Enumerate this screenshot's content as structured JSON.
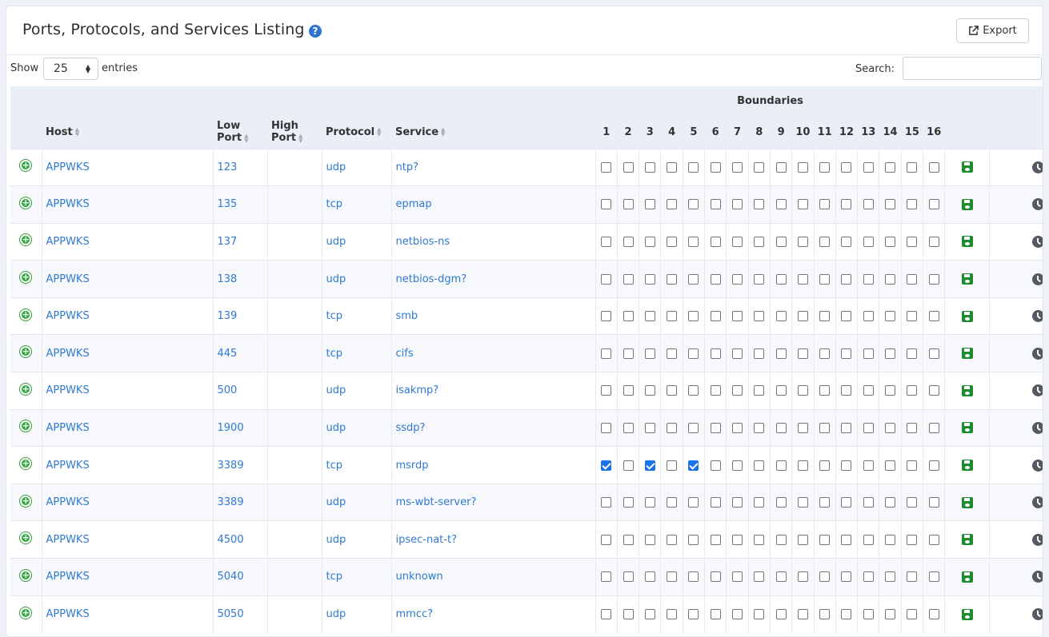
{
  "header": {
    "title": "Ports, Protocols, and Services Listing",
    "help_icon": "question-circle-icon",
    "export_label": "Export"
  },
  "controls": {
    "show_label": "Show",
    "entries_value": "25",
    "entries_label": "entries",
    "search_label": "Search:",
    "search_value": ""
  },
  "table": {
    "boundaries_label": "Boundaries",
    "columns": {
      "host": "Host",
      "low_port_1": "Low",
      "low_port_2": "Port",
      "high_port_1": "High",
      "high_port_2": "Port",
      "protocol": "Protocol",
      "service": "Service"
    },
    "boundary_numbers": [
      "1",
      "2",
      "3",
      "4",
      "5",
      "6",
      "7",
      "8",
      "9",
      "10",
      "11",
      "12",
      "13",
      "14",
      "15",
      "16"
    ],
    "rows": [
      {
        "host": "APPWKS",
        "low_port": "123",
        "high_port": "",
        "protocol": "udp",
        "service": "ntp?",
        "checked": []
      },
      {
        "host": "APPWKS",
        "low_port": "135",
        "high_port": "",
        "protocol": "tcp",
        "service": "epmap",
        "checked": []
      },
      {
        "host": "APPWKS",
        "low_port": "137",
        "high_port": "",
        "protocol": "udp",
        "service": "netbios-ns",
        "checked": []
      },
      {
        "host": "APPWKS",
        "low_port": "138",
        "high_port": "",
        "protocol": "udp",
        "service": "netbios-dgm?",
        "checked": []
      },
      {
        "host": "APPWKS",
        "low_port": "139",
        "high_port": "",
        "protocol": "tcp",
        "service": "smb",
        "checked": []
      },
      {
        "host": "APPWKS",
        "low_port": "445",
        "high_port": "",
        "protocol": "tcp",
        "service": "cifs",
        "checked": []
      },
      {
        "host": "APPWKS",
        "low_port": "500",
        "high_port": "",
        "protocol": "udp",
        "service": "isakmp?",
        "checked": []
      },
      {
        "host": "APPWKS",
        "low_port": "1900",
        "high_port": "",
        "protocol": "udp",
        "service": "ssdp?",
        "checked": []
      },
      {
        "host": "APPWKS",
        "low_port": "3389",
        "high_port": "",
        "protocol": "tcp",
        "service": "msrdp",
        "checked": [
          1,
          3,
          5
        ]
      },
      {
        "host": "APPWKS",
        "low_port": "3389",
        "high_port": "",
        "protocol": "udp",
        "service": "ms-wbt-server?",
        "checked": []
      },
      {
        "host": "APPWKS",
        "low_port": "4500",
        "high_port": "",
        "protocol": "udp",
        "service": "ipsec-nat-t?",
        "checked": []
      },
      {
        "host": "APPWKS",
        "low_port": "5040",
        "high_port": "",
        "protocol": "tcp",
        "service": "unknown",
        "checked": []
      },
      {
        "host": "APPWKS",
        "low_port": "5050",
        "high_port": "",
        "protocol": "udp",
        "service": "mmcc?",
        "checked": []
      }
    ]
  },
  "colors": {
    "link": "#2f7ad0",
    "header_bg": "#e9eef7",
    "save_green": "#1e8b2e",
    "add_green": "#35a843",
    "checkbox_blue": "#1a73e8"
  }
}
